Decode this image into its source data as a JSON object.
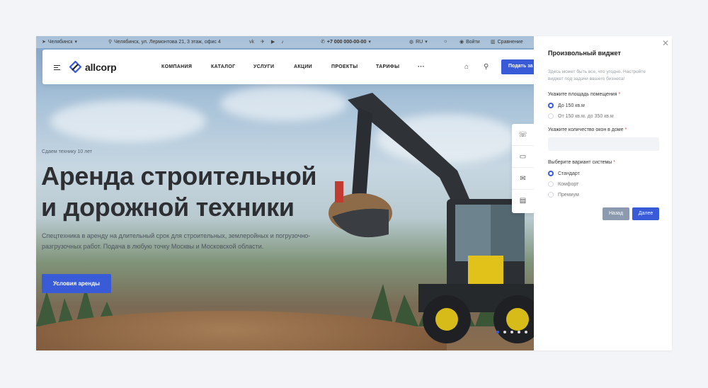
{
  "topbar": {
    "city": "Челябинск",
    "address": "Челябинск, ул. Лермонтова 21, 3 этаж, офис 4",
    "phone": "+7 000 000-00-00",
    "lang": "RU",
    "login": "Войти",
    "compare": "Сравнение"
  },
  "header": {
    "logo": "allcorp",
    "nav": [
      "КОМПАНИЯ",
      "КАТАЛОГ",
      "УСЛУГИ",
      "АКЦИИ",
      "ПРОЕКТЫ",
      "ТАРИФЫ"
    ],
    "more": "···",
    "request_button": "Подать за"
  },
  "hero": {
    "subtitle": "Сдаем технику 10 лет",
    "title_line1": "Аренда строительной",
    "title_line2": "и дорожной техники",
    "description": "Спецтехника в аренду на длительный срок для строительных, землеройных и погрузочно-разгрузочных работ. Подача в любую точку Москвы и Московской области.",
    "cta": "Условия аренды"
  },
  "panel": {
    "title": "Произвольный виджет",
    "description": "Здесь может быть все, что угодно. Настройте виджет под задачи вашего бизнеса!",
    "q1_label": "Укажите площадь помещения",
    "q1_options": [
      "До 150 кв.м",
      "От 150 кв.м. до 350 кв.м"
    ],
    "q2_label": "Укажите количество окон в доме",
    "q3_label": "Выберите вариант системы",
    "q3_options": [
      "Стандарт",
      "Комфорт",
      "Премиум"
    ],
    "required_mark": "*",
    "back": "Назад",
    "next": "Далее"
  },
  "colors": {
    "accent": "#3a5bd8",
    "back_button": "#8c9aaf",
    "required": "#e0453a"
  }
}
